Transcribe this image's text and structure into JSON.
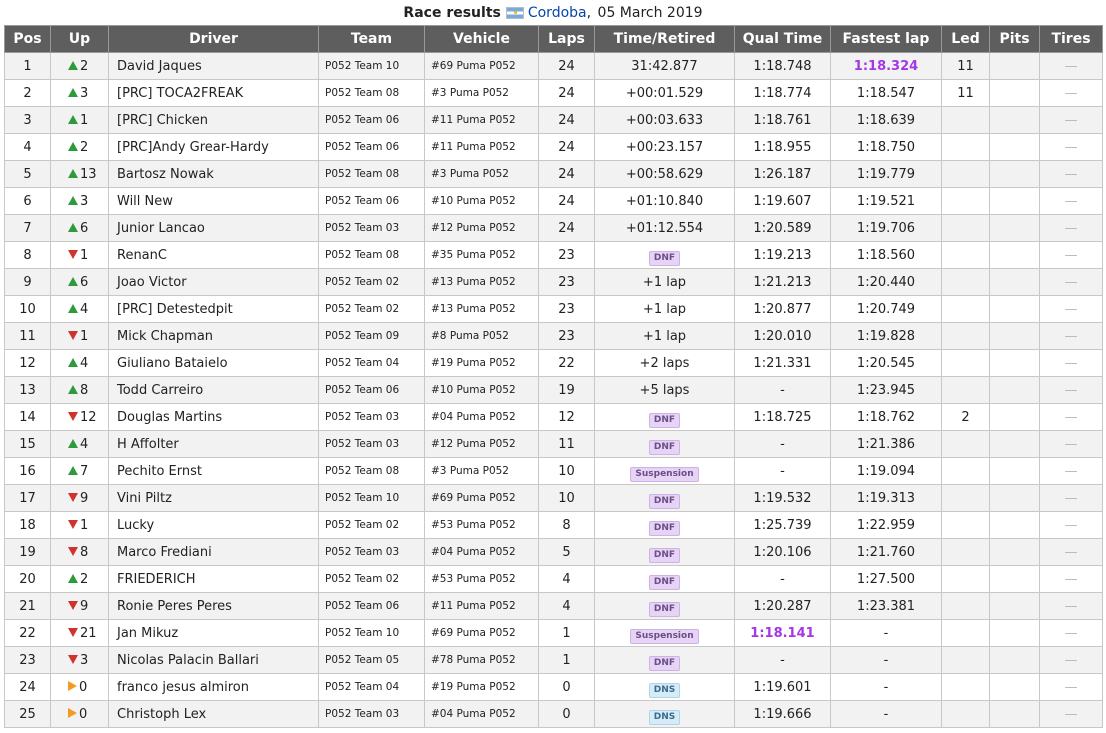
{
  "caption": {
    "title": "Race results",
    "place": "Cordoba",
    "date": "05 March 2019"
  },
  "headers": [
    "Pos",
    "Up",
    "Driver",
    "Team",
    "Vehicle",
    "Laps",
    "Time/Retired",
    "Qual Time",
    "Fastest lap",
    "Led",
    "Pits",
    "Tires"
  ],
  "rows": [
    {
      "pos": "1",
      "dir": "up",
      "up": "2",
      "driver": "David Jaques",
      "team": "P052 Team 10",
      "vehicle": "#69 Puma P052",
      "laps": "24",
      "time": "31:42.877",
      "qual": "1:18.748",
      "fastest": "1:18.324",
      "fastest_best": true,
      "led": "11",
      "pits": "",
      "tires": "—"
    },
    {
      "pos": "2",
      "dir": "up",
      "up": "3",
      "driver": "[PRC] TOCA2FREAK",
      "team": "P052 Team 08",
      "vehicle": "#3 Puma P052",
      "laps": "24",
      "time": "+00:01.529",
      "qual": "1:18.774",
      "fastest": "1:18.547",
      "led": "11",
      "pits": "",
      "tires": "—"
    },
    {
      "pos": "3",
      "dir": "up",
      "up": "1",
      "driver": "[PRC] Chicken",
      "team": "P052 Team 06",
      "vehicle": "#11 Puma P052",
      "laps": "24",
      "time": "+00:03.633",
      "qual": "1:18.761",
      "fastest": "1:18.639",
      "led": "",
      "pits": "",
      "tires": "—"
    },
    {
      "pos": "4",
      "dir": "up",
      "up": "2",
      "driver": "[PRC]Andy Grear-Hardy",
      "team": "P052 Team 06",
      "vehicle": "#11 Puma P052",
      "laps": "24",
      "time": "+00:23.157",
      "qual": "1:18.955",
      "fastest": "1:18.750",
      "led": "",
      "pits": "",
      "tires": "—"
    },
    {
      "pos": "5",
      "dir": "up",
      "up": "13",
      "driver": "Bartosz Nowak",
      "team": "P052 Team 08",
      "vehicle": "#3 Puma P052",
      "laps": "24",
      "time": "+00:58.629",
      "qual": "1:26.187",
      "fastest": "1:19.779",
      "led": "",
      "pits": "",
      "tires": "—"
    },
    {
      "pos": "6",
      "dir": "up",
      "up": "3",
      "driver": "Will New",
      "team": "P052 Team 06",
      "vehicle": "#10 Puma P052",
      "laps": "24",
      "time": "+01:10.840",
      "qual": "1:19.607",
      "fastest": "1:19.521",
      "led": "",
      "pits": "",
      "tires": "—"
    },
    {
      "pos": "7",
      "dir": "up",
      "up": "6",
      "driver": "Junior Lancao",
      "team": "P052 Team 03",
      "vehicle": "#12 Puma P052",
      "laps": "24",
      "time": "+01:12.554",
      "qual": "1:20.589",
      "fastest": "1:19.706",
      "led": "",
      "pits": "",
      "tires": "—"
    },
    {
      "pos": "8",
      "dir": "down",
      "up": "1",
      "driver": "RenanC",
      "team": "P052 Team 08",
      "vehicle": "#35 Puma P052",
      "laps": "23",
      "time": "DNF",
      "time_badge": "dnf",
      "qual": "1:19.213",
      "fastest": "1:18.560",
      "led": "",
      "pits": "",
      "tires": "—"
    },
    {
      "pos": "9",
      "dir": "up",
      "up": "6",
      "driver": "Joao Victor",
      "team": "P052 Team 02",
      "vehicle": "#13 Puma P052",
      "laps": "23",
      "time": "+1 lap",
      "qual": "1:21.213",
      "fastest": "1:20.440",
      "led": "",
      "pits": "",
      "tires": "—"
    },
    {
      "pos": "10",
      "dir": "up",
      "up": "4",
      "driver": "[PRC] Detestedpit",
      "team": "P052 Team 02",
      "vehicle": "#13 Puma P052",
      "laps": "23",
      "time": "+1 lap",
      "qual": "1:20.877",
      "fastest": "1:20.749",
      "led": "",
      "pits": "",
      "tires": "—"
    },
    {
      "pos": "11",
      "dir": "down",
      "up": "1",
      "driver": "Mick Chapman",
      "team": "P052 Team 09",
      "vehicle": "#8 Puma P052",
      "laps": "23",
      "time": "+1 lap",
      "qual": "1:20.010",
      "fastest": "1:19.828",
      "led": "",
      "pits": "",
      "tires": "—"
    },
    {
      "pos": "12",
      "dir": "up",
      "up": "4",
      "driver": "Giuliano Bataielo",
      "team": "P052 Team 04",
      "vehicle": "#19 Puma P052",
      "laps": "22",
      "time": "+2 laps",
      "qual": "1:21.331",
      "fastest": "1:20.545",
      "led": "",
      "pits": "",
      "tires": "—"
    },
    {
      "pos": "13",
      "dir": "up",
      "up": "8",
      "driver": "Todd Carreiro",
      "team": "P052 Team 06",
      "vehicle": "#10 Puma P052",
      "laps": "19",
      "time": "+5 laps",
      "qual": "-",
      "fastest": "1:23.945",
      "led": "",
      "pits": "",
      "tires": "—"
    },
    {
      "pos": "14",
      "dir": "down",
      "up": "12",
      "driver": "Douglas Martins",
      "team": "P052 Team 03",
      "vehicle": "#04 Puma P052",
      "laps": "12",
      "time": "DNF",
      "time_badge": "dnf",
      "qual": "1:18.725",
      "fastest": "1:18.762",
      "led": "2",
      "pits": "",
      "tires": "—"
    },
    {
      "pos": "15",
      "dir": "up",
      "up": "4",
      "driver": "H Affolter",
      "team": "P052 Team 03",
      "vehicle": "#12 Puma P052",
      "laps": "11",
      "time": "DNF",
      "time_badge": "dnf",
      "qual": "-",
      "fastest": "1:21.386",
      "led": "",
      "pits": "",
      "tires": "—"
    },
    {
      "pos": "16",
      "dir": "up",
      "up": "7",
      "driver": "Pechito Ernst",
      "team": "P052 Team 08",
      "vehicle": "#3 Puma P052",
      "laps": "10",
      "time": "Suspension",
      "time_badge": "suspension",
      "qual": "-",
      "fastest": "1:19.094",
      "led": "",
      "pits": "",
      "tires": "—"
    },
    {
      "pos": "17",
      "dir": "down",
      "up": "9",
      "driver": "Vini Piltz",
      "team": "P052 Team 10",
      "vehicle": "#69 Puma P052",
      "laps": "10",
      "time": "DNF",
      "time_badge": "dnf",
      "qual": "1:19.532",
      "fastest": "1:19.313",
      "led": "",
      "pits": "",
      "tires": "—"
    },
    {
      "pos": "18",
      "dir": "down",
      "up": "1",
      "driver": "Lucky",
      "team": "P052 Team 02",
      "vehicle": "#53 Puma P052",
      "laps": "8",
      "time": "DNF",
      "time_badge": "dnf",
      "qual": "1:25.739",
      "fastest": "1:22.959",
      "led": "",
      "pits": "",
      "tires": "—"
    },
    {
      "pos": "19",
      "dir": "down",
      "up": "8",
      "driver": "Marco Frediani",
      "team": "P052 Team 03",
      "vehicle": "#04 Puma P052",
      "laps": "5",
      "time": "DNF",
      "time_badge": "dnf",
      "qual": "1:20.106",
      "fastest": "1:21.760",
      "led": "",
      "pits": "",
      "tires": "—"
    },
    {
      "pos": "20",
      "dir": "up",
      "up": "2",
      "driver": "FRIEDERICH",
      "team": "P052 Team 02",
      "vehicle": "#53 Puma P052",
      "laps": "4",
      "time": "DNF",
      "time_badge": "dnf",
      "qual": "-",
      "fastest": "1:27.500",
      "led": "",
      "pits": "",
      "tires": "—"
    },
    {
      "pos": "21",
      "dir": "down",
      "up": "9",
      "driver": "Ronie Peres Peres",
      "team": "P052 Team 06",
      "vehicle": "#11 Puma P052",
      "laps": "4",
      "time": "DNF",
      "time_badge": "dnf",
      "qual": "1:20.287",
      "fastest": "1:23.381",
      "led": "",
      "pits": "",
      "tires": "—"
    },
    {
      "pos": "22",
      "dir": "down",
      "up": "21",
      "driver": "Jan Mikuz",
      "team": "P052 Team 10",
      "vehicle": "#69 Puma P052",
      "laps": "1",
      "time": "Suspension",
      "time_badge": "suspension",
      "qual": "1:18.141",
      "qual_best": true,
      "fastest": "-",
      "led": "",
      "pits": "",
      "tires": "—"
    },
    {
      "pos": "23",
      "dir": "down",
      "up": "3",
      "driver": "Nicolas Palacin Ballari",
      "team": "P052 Team 05",
      "vehicle": "#78 Puma P052",
      "laps": "1",
      "time": "DNF",
      "time_badge": "dnf",
      "qual": "-",
      "fastest": "-",
      "led": "",
      "pits": "",
      "tires": "—"
    },
    {
      "pos": "24",
      "dir": "same",
      "up": "0",
      "driver": "franco jesus almiron",
      "team": "P052 Team 04",
      "vehicle": "#19 Puma P052",
      "laps": "0",
      "time": "DNS",
      "time_badge": "dns",
      "qual": "1:19.601",
      "fastest": "-",
      "led": "",
      "pits": "",
      "tires": "—"
    },
    {
      "pos": "25",
      "dir": "same",
      "up": "0",
      "driver": "Christoph Lex",
      "team": "P052 Team 03",
      "vehicle": "#04 Puma P052",
      "laps": "0",
      "time": "DNS",
      "time_badge": "dns",
      "qual": "1:19.666",
      "fastest": "-",
      "led": "",
      "pits": "",
      "tires": "—"
    }
  ],
  "colors": {
    "header_bg": "#5e5e5e",
    "up": "#2e9b3a",
    "down": "#d0332b",
    "same": "#f39a23",
    "best": "#a436e8"
  }
}
